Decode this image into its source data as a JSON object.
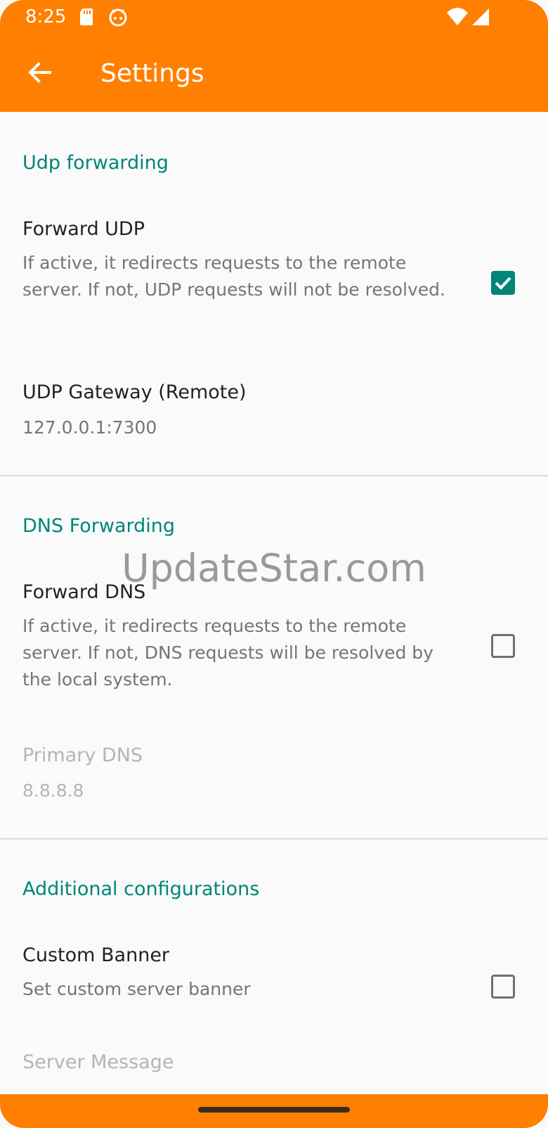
{
  "status_bar": {
    "time": "8:25"
  },
  "app_bar": {
    "title": "Settings",
    "back_icon": "arrow-back-icon"
  },
  "sections": {
    "udp": {
      "header": "Udp forwarding",
      "forward_udp": {
        "title": "Forward UDP",
        "summary": "If active, it redirects requests to the remote server. If not, UDP requests will not be resolved.",
        "checked": true
      },
      "udp_gateway": {
        "title": "UDP Gateway (Remote)",
        "value": "127.0.0.1:7300"
      }
    },
    "dns": {
      "header": "DNS Forwarding",
      "forward_dns": {
        "title": "Forward DNS",
        "summary": "If active, it redirects requests to the remote server. If not, DNS requests will be resolved by the local system.",
        "checked": false
      },
      "primary_dns": {
        "title": "Primary DNS",
        "value": "8.8.8.8"
      }
    },
    "additional": {
      "header": "Additional configurations",
      "custom_banner": {
        "title": "Custom Banner",
        "summary": "Set custom server banner",
        "checked": false
      },
      "server_message": {
        "title": "Server Message"
      }
    }
  },
  "watermark": "UpdateStar.com",
  "colors": {
    "app_bar": "#ff8000",
    "accent": "#008577",
    "background": "#fafafa"
  }
}
